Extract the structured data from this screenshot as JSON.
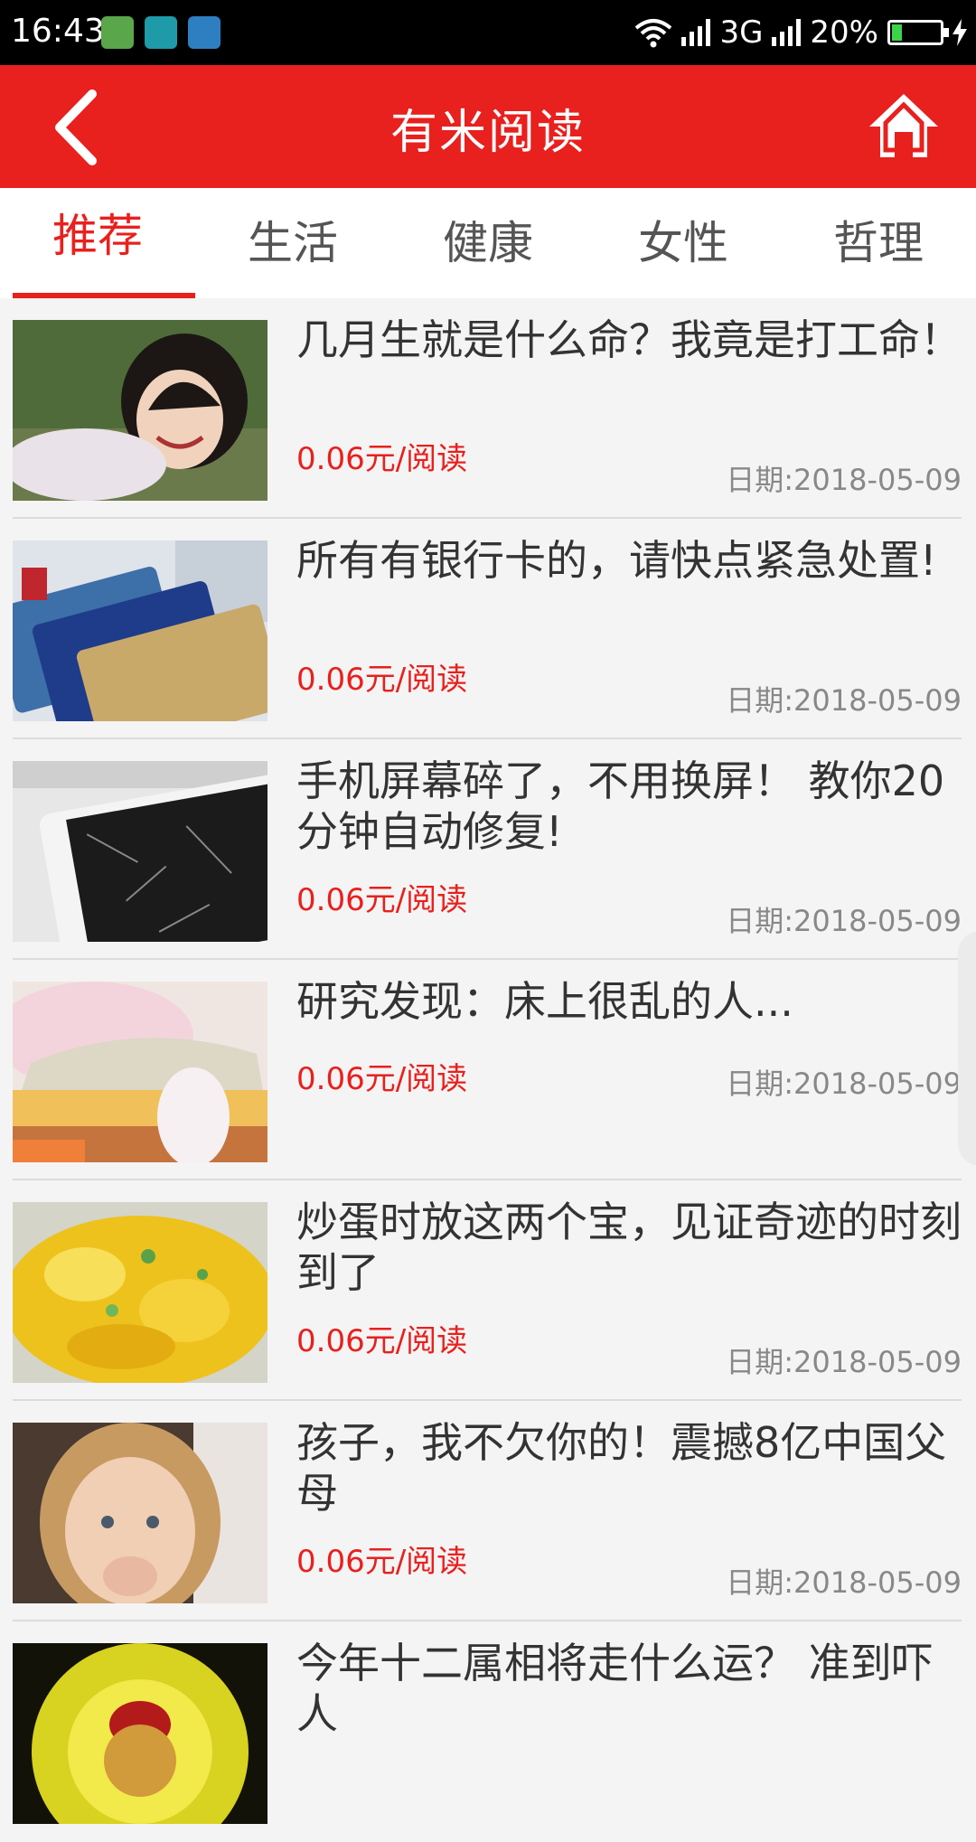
{
  "status_bar": {
    "time": "16:43",
    "network": "3G",
    "battery": "20%",
    "battery_level": 0.2
  },
  "header": {
    "title": "有米阅读",
    "back_icon": "chevron-left-icon",
    "home_icon": "home-icon"
  },
  "tabs": [
    {
      "label": "推荐",
      "active": true
    },
    {
      "label": "生活",
      "active": false
    },
    {
      "label": "健康",
      "active": false
    },
    {
      "label": "女性",
      "active": false
    },
    {
      "label": "哲理",
      "active": false
    }
  ],
  "colors": {
    "accent": "#e8201e",
    "background": "#f4f4f4"
  },
  "articles": [
    {
      "title": "几月生就是什么命？我竟是打工命！",
      "price": "0.06元/阅读",
      "date": "日期:2018-05-09"
    },
    {
      "title": "所有有银行卡的，请快点紧急处置!",
      "price": "0.06元/阅读",
      "date": "日期:2018-05-09"
    },
    {
      "title": "手机屏幕碎了，不用换屏！ 教你20分钟自动修复!",
      "price": "0.06元/阅读",
      "date": "日期:2018-05-09"
    },
    {
      "title": "研究发现：床上很乱的人...",
      "price": "0.06元/阅读",
      "date": "日期:2018-05-09"
    },
    {
      "title": "炒蛋时放这两个宝，见证奇迹的时刻到了",
      "price": "0.06元/阅读",
      "date": "日期:2018-05-09"
    },
    {
      "title": "孩子，我不欠你的！震撼8亿中国父母",
      "price": "0.06元/阅读",
      "date": "日期:2018-05-09"
    },
    {
      "title": "今年十二属相将走什么运？ 准到吓人",
      "price": "",
      "date": ""
    }
  ]
}
